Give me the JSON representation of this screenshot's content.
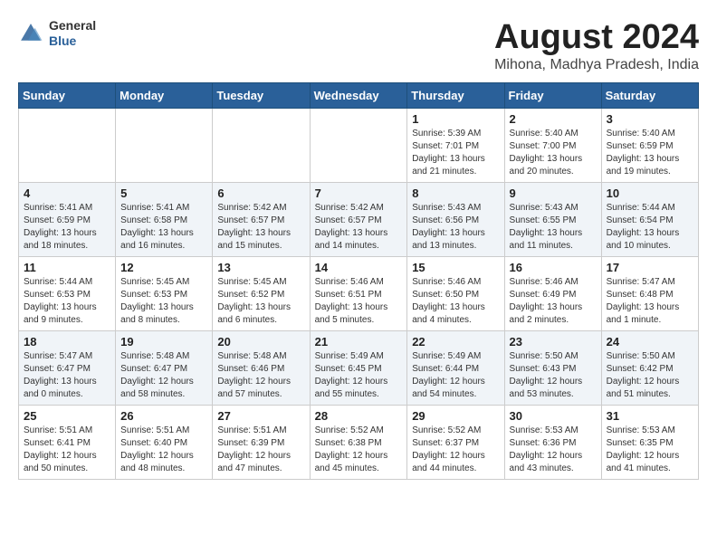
{
  "header": {
    "logo_general": "General",
    "logo_blue": "Blue",
    "month_year": "August 2024",
    "location": "Mihona, Madhya Pradesh, India"
  },
  "weekdays": [
    "Sunday",
    "Monday",
    "Tuesday",
    "Wednesday",
    "Thursday",
    "Friday",
    "Saturday"
  ],
  "weeks": [
    [
      {
        "day": "",
        "detail": ""
      },
      {
        "day": "",
        "detail": ""
      },
      {
        "day": "",
        "detail": ""
      },
      {
        "day": "",
        "detail": ""
      },
      {
        "day": "1",
        "detail": "Sunrise: 5:39 AM\nSunset: 7:01 PM\nDaylight: 13 hours\nand 21 minutes."
      },
      {
        "day": "2",
        "detail": "Sunrise: 5:40 AM\nSunset: 7:00 PM\nDaylight: 13 hours\nand 20 minutes."
      },
      {
        "day": "3",
        "detail": "Sunrise: 5:40 AM\nSunset: 6:59 PM\nDaylight: 13 hours\nand 19 minutes."
      }
    ],
    [
      {
        "day": "4",
        "detail": "Sunrise: 5:41 AM\nSunset: 6:59 PM\nDaylight: 13 hours\nand 18 minutes."
      },
      {
        "day": "5",
        "detail": "Sunrise: 5:41 AM\nSunset: 6:58 PM\nDaylight: 13 hours\nand 16 minutes."
      },
      {
        "day": "6",
        "detail": "Sunrise: 5:42 AM\nSunset: 6:57 PM\nDaylight: 13 hours\nand 15 minutes."
      },
      {
        "day": "7",
        "detail": "Sunrise: 5:42 AM\nSunset: 6:57 PM\nDaylight: 13 hours\nand 14 minutes."
      },
      {
        "day": "8",
        "detail": "Sunrise: 5:43 AM\nSunset: 6:56 PM\nDaylight: 13 hours\nand 13 minutes."
      },
      {
        "day": "9",
        "detail": "Sunrise: 5:43 AM\nSunset: 6:55 PM\nDaylight: 13 hours\nand 11 minutes."
      },
      {
        "day": "10",
        "detail": "Sunrise: 5:44 AM\nSunset: 6:54 PM\nDaylight: 13 hours\nand 10 minutes."
      }
    ],
    [
      {
        "day": "11",
        "detail": "Sunrise: 5:44 AM\nSunset: 6:53 PM\nDaylight: 13 hours\nand 9 minutes."
      },
      {
        "day": "12",
        "detail": "Sunrise: 5:45 AM\nSunset: 6:53 PM\nDaylight: 13 hours\nand 8 minutes."
      },
      {
        "day": "13",
        "detail": "Sunrise: 5:45 AM\nSunset: 6:52 PM\nDaylight: 13 hours\nand 6 minutes."
      },
      {
        "day": "14",
        "detail": "Sunrise: 5:46 AM\nSunset: 6:51 PM\nDaylight: 13 hours\nand 5 minutes."
      },
      {
        "day": "15",
        "detail": "Sunrise: 5:46 AM\nSunset: 6:50 PM\nDaylight: 13 hours\nand 4 minutes."
      },
      {
        "day": "16",
        "detail": "Sunrise: 5:46 AM\nSunset: 6:49 PM\nDaylight: 13 hours\nand 2 minutes."
      },
      {
        "day": "17",
        "detail": "Sunrise: 5:47 AM\nSunset: 6:48 PM\nDaylight: 13 hours\nand 1 minute."
      }
    ],
    [
      {
        "day": "18",
        "detail": "Sunrise: 5:47 AM\nSunset: 6:47 PM\nDaylight: 13 hours\nand 0 minutes."
      },
      {
        "day": "19",
        "detail": "Sunrise: 5:48 AM\nSunset: 6:47 PM\nDaylight: 12 hours\nand 58 minutes."
      },
      {
        "day": "20",
        "detail": "Sunrise: 5:48 AM\nSunset: 6:46 PM\nDaylight: 12 hours\nand 57 minutes."
      },
      {
        "day": "21",
        "detail": "Sunrise: 5:49 AM\nSunset: 6:45 PM\nDaylight: 12 hours\nand 55 minutes."
      },
      {
        "day": "22",
        "detail": "Sunrise: 5:49 AM\nSunset: 6:44 PM\nDaylight: 12 hours\nand 54 minutes."
      },
      {
        "day": "23",
        "detail": "Sunrise: 5:50 AM\nSunset: 6:43 PM\nDaylight: 12 hours\nand 53 minutes."
      },
      {
        "day": "24",
        "detail": "Sunrise: 5:50 AM\nSunset: 6:42 PM\nDaylight: 12 hours\nand 51 minutes."
      }
    ],
    [
      {
        "day": "25",
        "detail": "Sunrise: 5:51 AM\nSunset: 6:41 PM\nDaylight: 12 hours\nand 50 minutes."
      },
      {
        "day": "26",
        "detail": "Sunrise: 5:51 AM\nSunset: 6:40 PM\nDaylight: 12 hours\nand 48 minutes."
      },
      {
        "day": "27",
        "detail": "Sunrise: 5:51 AM\nSunset: 6:39 PM\nDaylight: 12 hours\nand 47 minutes."
      },
      {
        "day": "28",
        "detail": "Sunrise: 5:52 AM\nSunset: 6:38 PM\nDaylight: 12 hours\nand 45 minutes."
      },
      {
        "day": "29",
        "detail": "Sunrise: 5:52 AM\nSunset: 6:37 PM\nDaylight: 12 hours\nand 44 minutes."
      },
      {
        "day": "30",
        "detail": "Sunrise: 5:53 AM\nSunset: 6:36 PM\nDaylight: 12 hours\nand 43 minutes."
      },
      {
        "day": "31",
        "detail": "Sunrise: 5:53 AM\nSunset: 6:35 PM\nDaylight: 12 hours\nand 41 minutes."
      }
    ]
  ]
}
